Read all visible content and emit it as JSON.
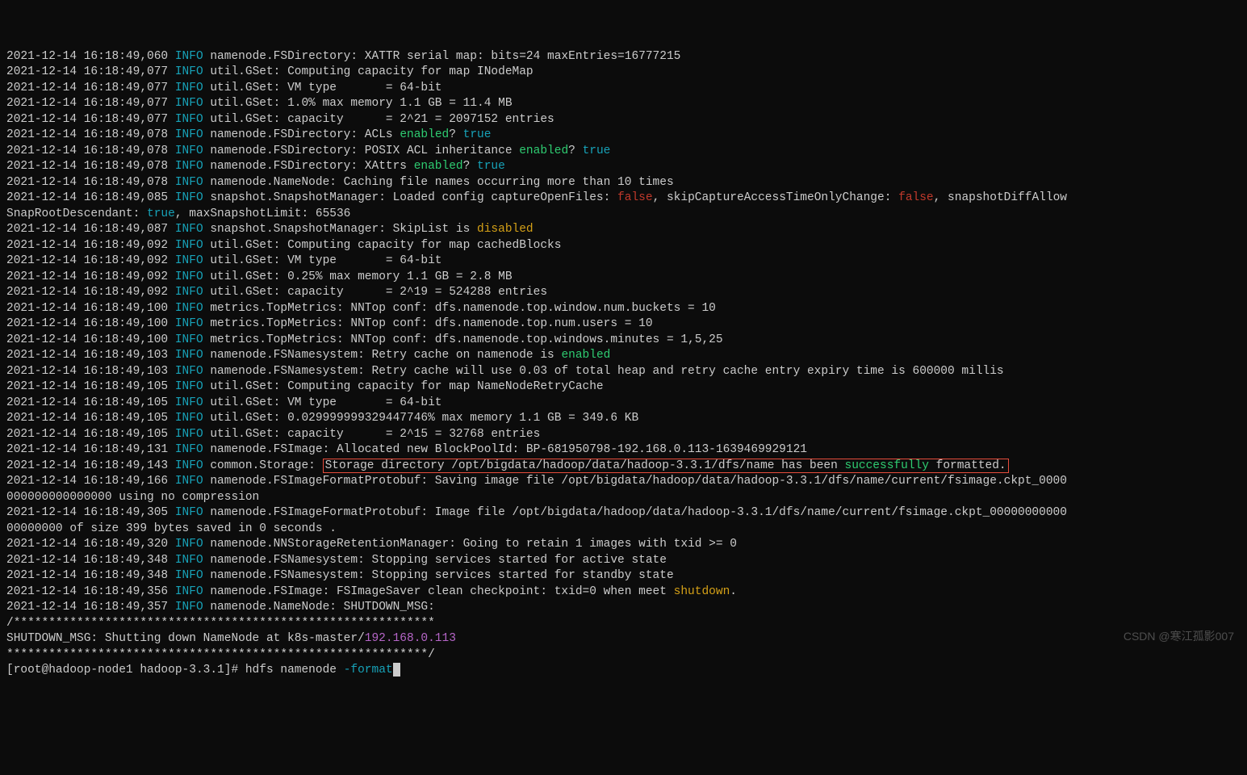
{
  "watermark": "CSDN @寒江孤影007",
  "prompt": {
    "text": "[root@hadoop-node1 hadoop-3.3.1]# ",
    "cmd": "hdfs namenode ",
    "opt": "-format"
  },
  "lines": {
    "0": {
      "ts": "2021-12-14 16:18:49,060",
      "lvl": "INFO",
      "msg": "namenode.FSDirectory: XATTR serial map: bits=24 maxEntries=16777215"
    },
    "1": {
      "ts": "2021-12-14 16:18:49,077",
      "lvl": "INFO",
      "msg": "util.GSet: Computing capacity for map INodeMap"
    },
    "2": {
      "ts": "2021-12-14 16:18:49,077",
      "lvl": "INFO",
      "msg": "util.GSet: VM type       = 64-bit"
    },
    "3": {
      "ts": "2021-12-14 16:18:49,077",
      "lvl": "INFO",
      "msg": "util.GSet: 1.0% max memory 1.1 GB = 11.4 MB"
    },
    "4": {
      "ts": "2021-12-14 16:18:49,077",
      "lvl": "INFO",
      "msg": "util.GSet: capacity      = 2^21 = 2097152 entries"
    },
    "5": {
      "ts": "2021-12-14 16:18:49,078",
      "lvl": "INFO",
      "pre": "namenode.FSDirectory: ACLs ",
      "kw": "enabled",
      "mid": "? ",
      "tv": "true"
    },
    "6": {
      "ts": "2021-12-14 16:18:49,078",
      "lvl": "INFO",
      "pre": "namenode.FSDirectory: POSIX ACL inheritance ",
      "kw": "enabled",
      "mid": "? ",
      "tv": "true"
    },
    "7": {
      "ts": "2021-12-14 16:18:49,078",
      "lvl": "INFO",
      "pre": "namenode.FSDirectory: XAttrs ",
      "kw": "enabled",
      "mid": "? ",
      "tv": "true"
    },
    "8": {
      "ts": "2021-12-14 16:18:49,078",
      "lvl": "INFO",
      "msg": "namenode.NameNode: Caching file names occurring more than 10 times"
    },
    "9": {
      "ts": "2021-12-14 16:18:49,085",
      "lvl": "INFO",
      "pre": "snapshot.SnapshotManager: Loaded config captureOpenFiles: ",
      "f1": "false",
      "mid": ", skipCaptureAccessTimeOnlyChange: ",
      "f2": "false",
      "post": ", snapshotDiffAllow"
    },
    "10": {
      "pre": "SnapRootDescendant: ",
      "tv": "true",
      "post": ", maxSnapshotLimit: 65536"
    },
    "11": {
      "ts": "2021-12-14 16:18:49,087",
      "lvl": "INFO",
      "pre": "snapshot.SnapshotManager: SkipList is ",
      "kw": "disabled"
    },
    "12": {
      "ts": "2021-12-14 16:18:49,092",
      "lvl": "INFO",
      "msg": "util.GSet: Computing capacity for map cachedBlocks"
    },
    "13": {
      "ts": "2021-12-14 16:18:49,092",
      "lvl": "INFO",
      "msg": "util.GSet: VM type       = 64-bit"
    },
    "14": {
      "ts": "2021-12-14 16:18:49,092",
      "lvl": "INFO",
      "msg": "util.GSet: 0.25% max memory 1.1 GB = 2.8 MB"
    },
    "15": {
      "ts": "2021-12-14 16:18:49,092",
      "lvl": "INFO",
      "msg": "util.GSet: capacity      = 2^19 = 524288 entries"
    },
    "16": {
      "ts": "2021-12-14 16:18:49,100",
      "lvl": "INFO",
      "msg": "metrics.TopMetrics: NNTop conf: dfs.namenode.top.window.num.buckets = 10"
    },
    "17": {
      "ts": "2021-12-14 16:18:49,100",
      "lvl": "INFO",
      "msg": "metrics.TopMetrics: NNTop conf: dfs.namenode.top.num.users = 10"
    },
    "18": {
      "ts": "2021-12-14 16:18:49,100",
      "lvl": "INFO",
      "msg": "metrics.TopMetrics: NNTop conf: dfs.namenode.top.windows.minutes = 1,5,25"
    },
    "19": {
      "ts": "2021-12-14 16:18:49,103",
      "lvl": "INFO",
      "pre": "namenode.FSNamesystem: Retry cache on namenode is ",
      "kw": "enabled"
    },
    "20": {
      "ts": "2021-12-14 16:18:49,103",
      "lvl": "INFO",
      "msg": "namenode.FSNamesystem: Retry cache will use 0.03 of total heap and retry cache entry expiry time is 600000 millis"
    },
    "21": {
      "ts": "2021-12-14 16:18:49,105",
      "lvl": "INFO",
      "msg": "util.GSet: Computing capacity for map NameNodeRetryCache"
    },
    "22": {
      "ts": "2021-12-14 16:18:49,105",
      "lvl": "INFO",
      "msg": "util.GSet: VM type       = 64-bit"
    },
    "23": {
      "ts": "2021-12-14 16:18:49,105",
      "lvl": "INFO",
      "msg": "util.GSet: 0.029999999329447746% max memory 1.1 GB = 349.6 KB"
    },
    "24": {
      "ts": "2021-12-14 16:18:49,105",
      "lvl": "INFO",
      "msg": "util.GSet: capacity      = 2^15 = 32768 entries"
    },
    "25": {
      "ts": "2021-12-14 16:18:49,131",
      "lvl": "INFO",
      "msg": "namenode.FSImage: Allocated new BlockPoolId: BP-681950798-192.168.0.113-1639469929121"
    },
    "hl": {
      "ts": "2021-12-14 16:18:49,143",
      "lvl": "INFO",
      "pre": "common.Storage: ",
      "h1": "Storage directory /opt/bigdata/hadoop/data/hadoop-3.3.1/dfs/name has been ",
      "kw": "successfully",
      "h2": " formatted."
    },
    "26": {
      "ts": "2021-12-14 16:18:49,166",
      "lvl": "INFO",
      "msg": "namenode.FSImageFormatProtobuf: Saving image file /opt/bigdata/hadoop/data/hadoop-3.3.1/dfs/name/current/fsimage.ckpt_0000"
    },
    "27": {
      "msg": "000000000000000 using no compression"
    },
    "28": {
      "ts": "2021-12-14 16:18:49,305",
      "lvl": "INFO",
      "msg": "namenode.FSImageFormatProtobuf: Image file /opt/bigdata/hadoop/data/hadoop-3.3.1/dfs/name/current/fsimage.ckpt_00000000000"
    },
    "29": {
      "msg": "00000000 of size 399 bytes saved in 0 seconds ."
    },
    "30": {
      "ts": "2021-12-14 16:18:49,320",
      "lvl": "INFO",
      "msg": "namenode.NNStorageRetentionManager: Going to retain 1 images with txid >= 0"
    },
    "31": {
      "ts": "2021-12-14 16:18:49,348",
      "lvl": "INFO",
      "msg": "namenode.FSNamesystem: Stopping services started for active state"
    },
    "32": {
      "ts": "2021-12-14 16:18:49,348",
      "lvl": "INFO",
      "msg": "namenode.FSNamesystem: Stopping services started for standby state"
    },
    "33": {
      "ts": "2021-12-14 16:18:49,356",
      "lvl": "INFO",
      "pre": "namenode.FSImage: FSImageSaver clean checkpoint: txid=0 when meet ",
      "kw": "shutdown",
      "post": "."
    },
    "34": {
      "ts": "2021-12-14 16:18:49,357",
      "lvl": "INFO",
      "msg": "namenode.NameNode: SHUTDOWN_MSG:"
    },
    "35": {
      "msg": "/************************************************************"
    },
    "36": {
      "pre": "SHUTDOWN_MSG: Shutting down NameNode at k8s-master/",
      "ip": "192.168.0.113"
    },
    "37": {
      "msg": "************************************************************/"
    }
  }
}
